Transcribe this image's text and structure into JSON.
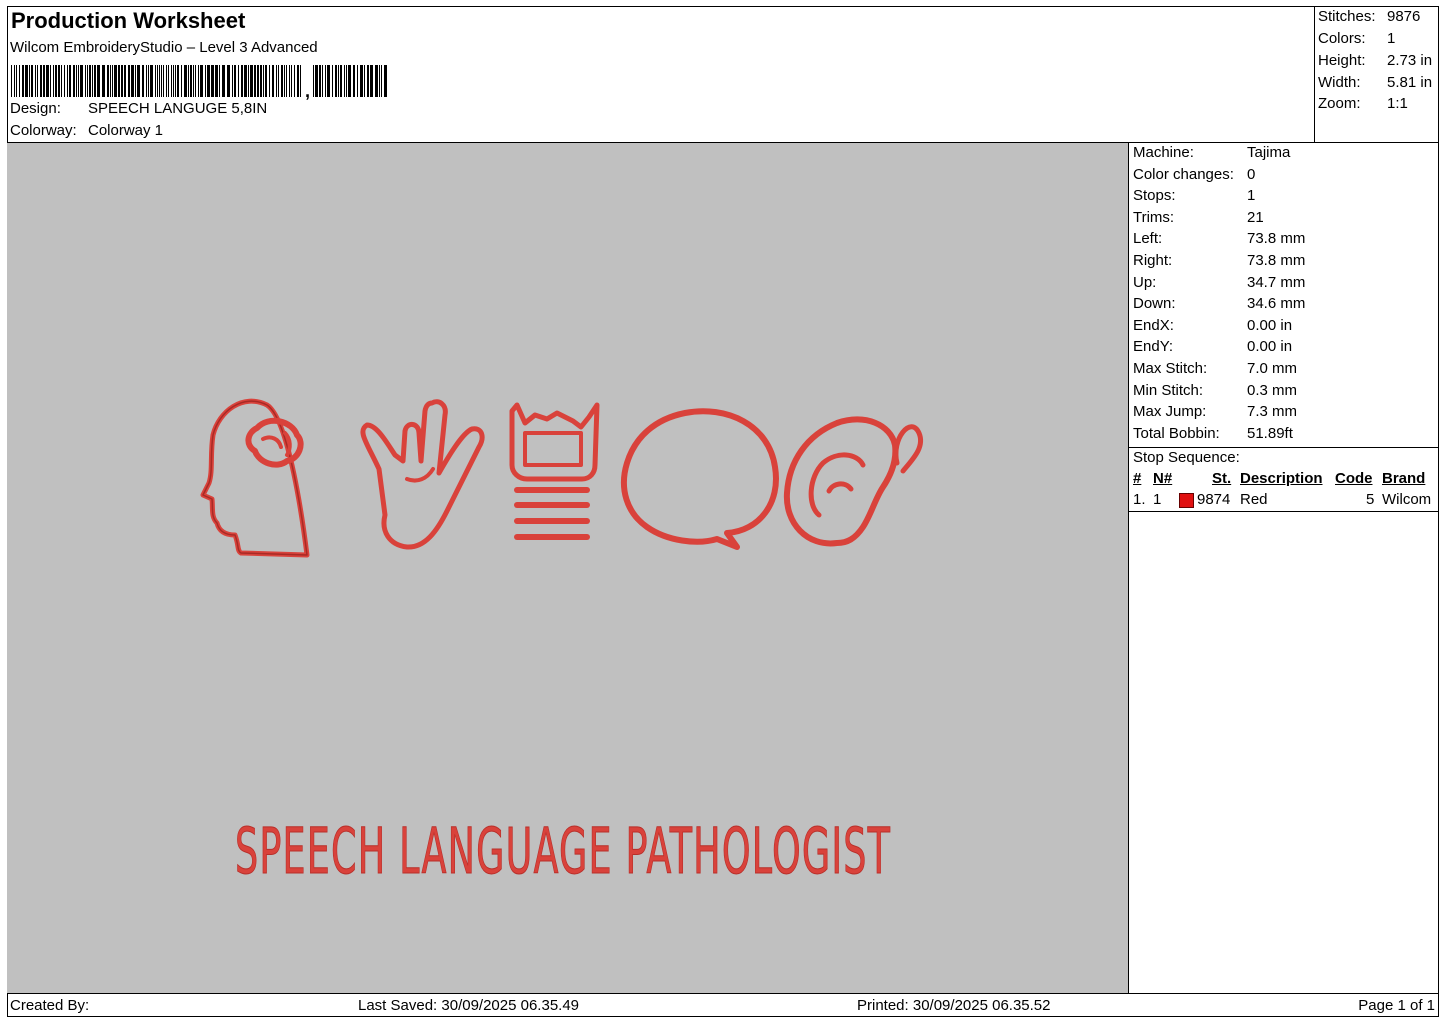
{
  "header": {
    "title": "Production Worksheet",
    "subtitle": "Wilcom EmbroideryStudio – Level 3 Advanced",
    "barcode_text": ",",
    "design_label": "Design:",
    "design_value": "SPEECH LANGUGE 5,8IN",
    "colorway_label": "Colorway:",
    "colorway_value": "Colorway 1"
  },
  "stats": [
    {
      "label": "Stitches:",
      "value": "9876"
    },
    {
      "label": "Colors:",
      "value": "1"
    },
    {
      "label": "Height:",
      "value": "2.73 in"
    },
    {
      "label": "Width:",
      "value": "5.81 in"
    },
    {
      "label": "Zoom:",
      "value": "1:1"
    }
  ],
  "machine_info": [
    {
      "label": "Machine:",
      "value": "Tajima"
    },
    {
      "label": "Color changes:",
      "value": "0"
    },
    {
      "label": "Stops:",
      "value": "1"
    },
    {
      "label": "Trims:",
      "value": "21"
    },
    {
      "label": "Left:",
      "value": "73.8 mm"
    },
    {
      "label": "Right:",
      "value": "73.8 mm"
    },
    {
      "label": "Up:",
      "value": "34.7 mm"
    },
    {
      "label": "Down:",
      "value": "34.6 mm"
    },
    {
      "label": "EndX:",
      "value": "0.00 in"
    },
    {
      "label": "EndY:",
      "value": "0.00 in"
    },
    {
      "label": "Max Stitch:",
      "value": "7.0 mm"
    },
    {
      "label": "Min Stitch:",
      "value": "0.3 mm"
    },
    {
      "label": "Max Jump:",
      "value": "7.3 mm"
    },
    {
      "label": "Total Bobbin:",
      "value": "51.89ft"
    }
  ],
  "stop_sequence": {
    "title": "Stop Sequence:",
    "headers": {
      "num": "#",
      "n": "N#",
      "st": "St.",
      "description": "Description",
      "code": "Code",
      "brand": "Brand"
    },
    "rows": [
      {
        "num": "1.",
        "n": "1",
        "color": "#e01010",
        "st": "9874",
        "description": "Red",
        "code": "5",
        "brand": "Wilcom"
      }
    ]
  },
  "design_canvas": {
    "background": "#c0c0c0",
    "thread_color": "#d9423b",
    "slogan": "SPEECH LANGUAGE PATHOLOGIST",
    "icons": [
      "head-brain-icon",
      "sign-language-hand-icon",
      "mouth-teeth-icon",
      "speech-bubble-icon",
      "ear-icon"
    ]
  },
  "footer": {
    "created_by": "Created By:",
    "last_saved": "Last Saved: 30/09/2025 06.35.49",
    "printed": "Printed: 30/09/2025 06.35.52",
    "page": "Page 1 of 1"
  }
}
